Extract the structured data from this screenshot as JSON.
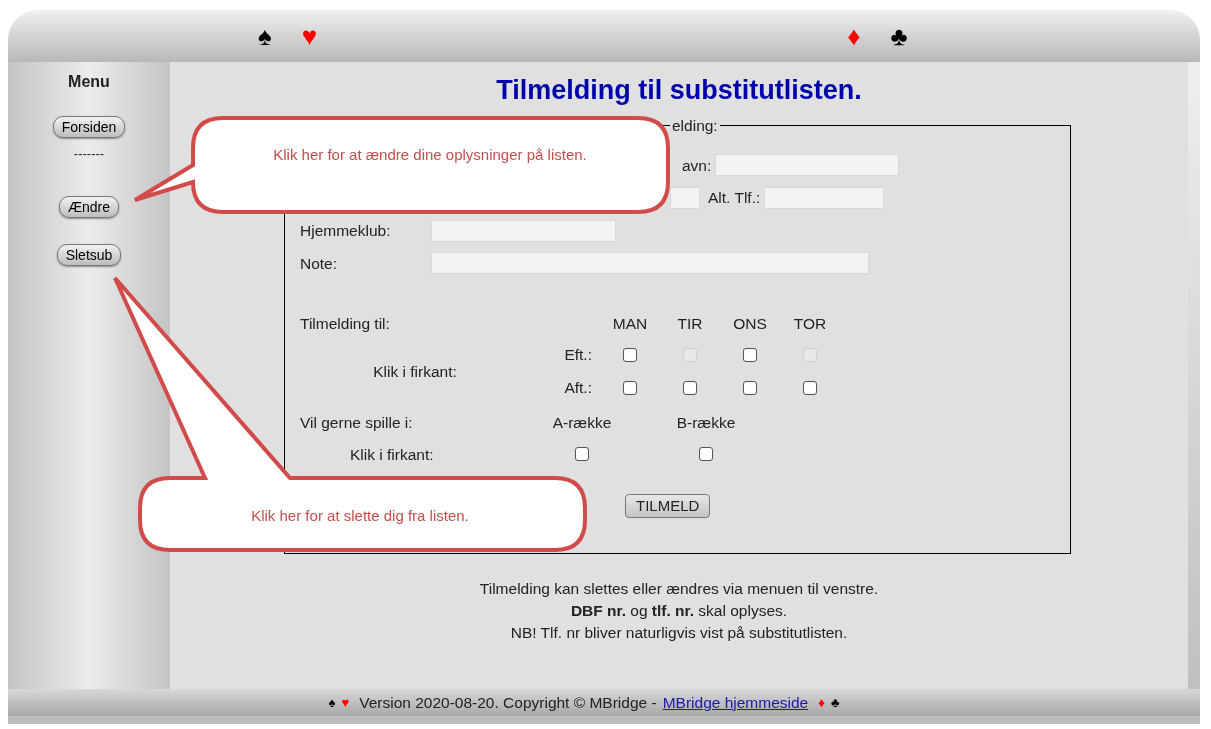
{
  "header": {
    "suits_left": [
      {
        "symbol": "♠",
        "color": "#000000"
      },
      {
        "symbol": "♥",
        "color": "#ff0000"
      }
    ],
    "suits_right": [
      {
        "symbol": "♦",
        "color": "#ff0000"
      },
      {
        "symbol": "♣",
        "color": "#000000"
      }
    ]
  },
  "sidebar": {
    "title": "Menu",
    "items": [
      {
        "kind": "button",
        "label": "Forsiden"
      },
      {
        "kind": "separator",
        "label": "-------"
      },
      {
        "kind": "button",
        "label": "Ændre"
      },
      {
        "kind": "button",
        "label": "Sletsub"
      }
    ]
  },
  "title": "Tilmelding til substitutlisten.",
  "form": {
    "legend": "elding:",
    "name_label": "avn:",
    "alt_phone_label": "Alt. Tlf.:",
    "club_label": "Hjemmeklub:",
    "note_label": "Note:",
    "days_label": "Tilmelding til:",
    "click_label": "Klik i firkant:",
    "days": [
      "MAN",
      "TIR",
      "ONS",
      "TOR"
    ],
    "slots": [
      {
        "label": "Eft.:",
        "boxes": [
          {
            "checked": false,
            "disabled": false
          },
          {
            "checked": false,
            "disabled": true
          },
          {
            "checked": false,
            "disabled": false
          },
          {
            "checked": false,
            "disabled": true
          }
        ]
      },
      {
        "label": "Aft.:",
        "boxes": [
          {
            "checked": false,
            "disabled": false
          },
          {
            "checked": false,
            "disabled": false
          },
          {
            "checked": false,
            "disabled": false
          },
          {
            "checked": false,
            "disabled": false
          }
        ]
      }
    ],
    "rows_label": "Vil gerne spille i:",
    "rows_click_label": "Klik i firkant:",
    "rows": [
      {
        "label": "A-række",
        "checked": false
      },
      {
        "label": "B-række",
        "checked": false
      }
    ],
    "submit": "TILMELD"
  },
  "notes": [
    "Tilmelding kan slettes eller ændres via menuen til venstre.",
    "**DBF nr.** og **tlf. nr.** skal oplyses.",
    "NB! Tlf. nr bliver naturligvis vist på substitutlisten."
  ],
  "callouts": [
    {
      "text": "Klik her for at ændre dine oplysninger på listen."
    },
    {
      "text": "Klik her for at slette dig fra listen."
    }
  ],
  "footer": {
    "suits_left": [
      {
        "symbol": "♠",
        "color": "#000000"
      },
      {
        "symbol": "♥",
        "color": "#ff0000"
      }
    ],
    "text": "Version 2020-08-20. Copyright © MBridge -",
    "link": "MBridge hjemmeside",
    "suits_right": [
      {
        "symbol": "♦",
        "color": "#ff0000"
      },
      {
        "symbol": "♣",
        "color": "#000000"
      }
    ]
  }
}
